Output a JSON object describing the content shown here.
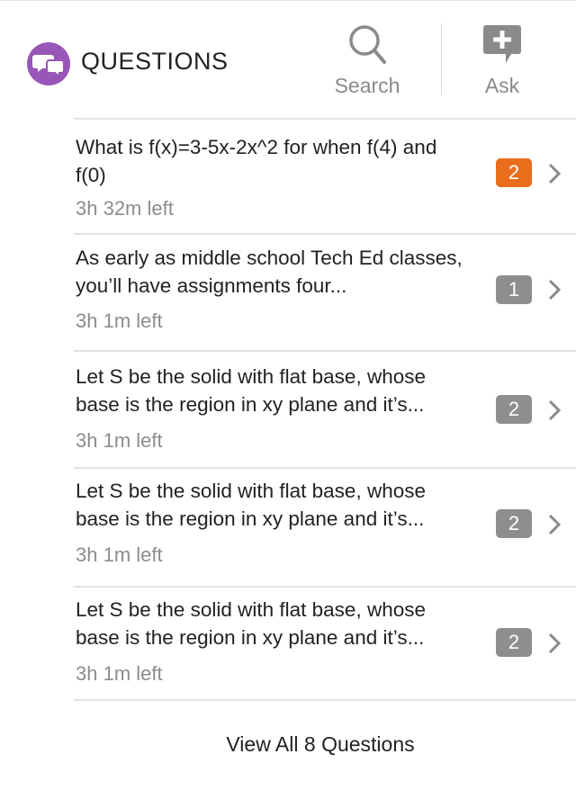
{
  "header": {
    "title": "QUESTIONS",
    "brand_icon": "speech-bubbles-icon",
    "brand_color": "#9857b8",
    "search_label": "Search",
    "ask_label": "Ask"
  },
  "questions": [
    {
      "text": "What is f(x)=3-5x-2x^2 for when f(4) and f(0)",
      "time_left": "3h 32m left",
      "answers": "2",
      "badge_color": "#ea6d1c"
    },
    {
      "text": "As early as middle school Tech Ed classes, you’ll have assignments four...",
      "time_left": "3h 1m left",
      "answers": "1",
      "badge_color": "#8e8e8e"
    },
    {
      "text": "Let S be the solid with flat base, whose base is the region in xy plane and it’s...",
      "time_left": "3h 1m left",
      "answers": "2",
      "badge_color": "#8e8e8e"
    },
    {
      "text": "Let S be the solid with flat base, whose base is the region in xy plane and it’s...",
      "time_left": "3h 1m left",
      "answers": "2",
      "badge_color": "#8e8e8e"
    },
    {
      "text": "Let S be the solid with flat base, whose base is the region in xy plane and it’s...",
      "time_left": "3h 1m left",
      "answers": "2",
      "badge_color": "#8e8e8e"
    }
  ],
  "footer": {
    "view_all_label": "View All 8 Questions"
  }
}
